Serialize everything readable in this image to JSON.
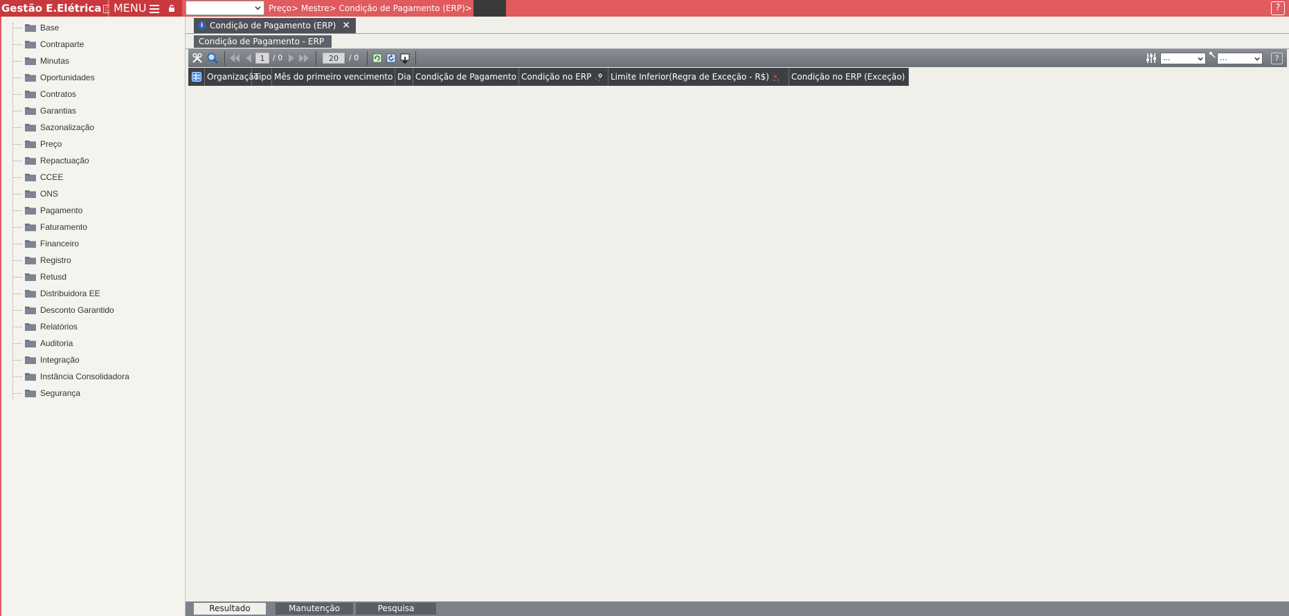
{
  "app": {
    "brand": "Gestão E.Elétrica",
    "menu_label": "MENU",
    "breadcrumb": "Preço> Mestre> Condição de Pagamento (ERP)>",
    "help": "?"
  },
  "sidebar": {
    "items": [
      {
        "label": "Base"
      },
      {
        "label": "Contraparte"
      },
      {
        "label": "Minutas"
      },
      {
        "label": "Oportunidades"
      },
      {
        "label": "Contratos"
      },
      {
        "label": "Garantias"
      },
      {
        "label": "Sazonalização"
      },
      {
        "label": "Preço"
      },
      {
        "label": "Repactuação"
      },
      {
        "label": "CCEE"
      },
      {
        "label": "ONS"
      },
      {
        "label": "Pagamento"
      },
      {
        "label": "Faturamento"
      },
      {
        "label": "Financeiro"
      },
      {
        "label": "Registro"
      },
      {
        "label": "Retusd"
      },
      {
        "label": "Distribuidora EE"
      },
      {
        "label": "Desconto Garantido"
      },
      {
        "label": "Relatórios"
      },
      {
        "label": "Auditoria"
      },
      {
        "label": "Integração"
      },
      {
        "label": "Instância Consolidadora"
      },
      {
        "label": "Segurança"
      }
    ]
  },
  "tabs": {
    "doc_tab": "Condição de Pagamento (ERP)",
    "close": "✕",
    "sub_tab": "Condição de Pagamento - ERP"
  },
  "toolbar": {
    "page_current": "1",
    "page_total": "/ 0",
    "page_size": "20",
    "record_total": "/ 0",
    "select1": "...",
    "select2": "...",
    "help": "?"
  },
  "grid": {
    "columns": [
      "Organização",
      "Tipo",
      "Mês do primeiro vencimento",
      "Dia",
      "Condição de Pagamento",
      "Condição no ERP",
      "Limite Inferior(Regra de Exceção - R$)",
      "Condição no ERP (Exceção)"
    ]
  },
  "bottom_tabs": {
    "resultado": "Resultado",
    "manutencao": "Manutenção",
    "pesquisa": "Pesquisa"
  }
}
